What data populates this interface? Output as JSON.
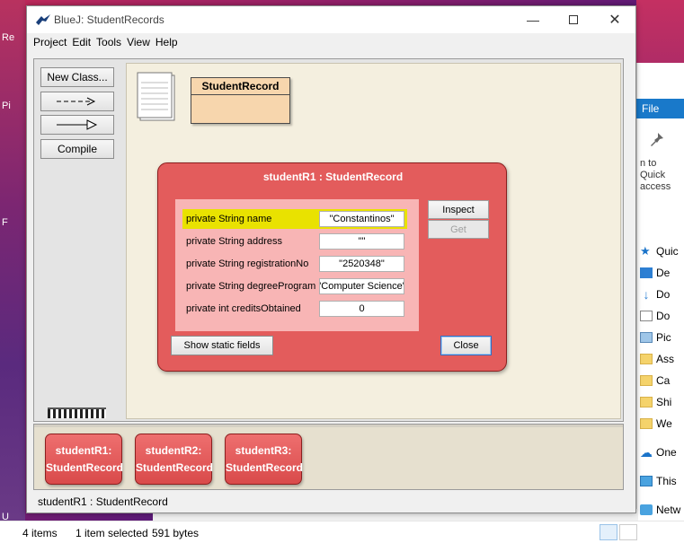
{
  "explorer": {
    "left_fragments": [
      "Re",
      "Pi",
      "F",
      "U"
    ],
    "ribbon_tab": "File",
    "pin_label": "n to Quick access",
    "nav_items": [
      {
        "label": "Quic",
        "icon": "star-icon"
      },
      {
        "label": "De",
        "icon": "desktop-icon"
      },
      {
        "label": "Do",
        "icon": "downloads-icon"
      },
      {
        "label": "Do",
        "icon": "documents-icon"
      },
      {
        "label": "Pic",
        "icon": "pictures-icon"
      },
      {
        "label": "Ass",
        "icon": "folder-icon"
      },
      {
        "label": "Ca",
        "icon": "folder-icon"
      },
      {
        "label": "Shi",
        "icon": "folder-icon"
      },
      {
        "label": "We",
        "icon": "folder-icon"
      },
      {
        "label": "One",
        "icon": "onedrive-icon"
      },
      {
        "label": "This",
        "icon": "this-pc-icon"
      },
      {
        "label": "Netw",
        "icon": "network-icon"
      }
    ],
    "status": {
      "items": "4 items",
      "selected": "1 item selected",
      "size": "591 bytes"
    }
  },
  "bluej": {
    "title": "BlueJ:  StudentRecords",
    "menu": [
      "Project",
      "Edit",
      "Tools",
      "View",
      "Help"
    ],
    "toolbar": {
      "new_class": "New Class...",
      "dep_arrow": "---->",
      "inh_arrow": "——▷",
      "compile": "Compile"
    },
    "class_name": "StudentRecord",
    "inspector": {
      "title": "studentR1 : StudentRecord",
      "fields": [
        {
          "label": "private String name",
          "value": "\"Constantinos\""
        },
        {
          "label": "private String address",
          "value": "\"\""
        },
        {
          "label": "private String registrationNo",
          "value": "\"2520348\""
        },
        {
          "label": "private String degreeProgram",
          "value": "\"Computer Science\""
        },
        {
          "label": "private int creditsObtained",
          "value": "0"
        }
      ],
      "inspect_label": "Inspect",
      "get_label": "Get",
      "show_static_label": "Show static fields",
      "close_label": "Close"
    },
    "objects": [
      {
        "line1": "studentR1:",
        "line2": "StudentRecord"
      },
      {
        "line1": "studentR2:",
        "line2": "StudentRecord"
      },
      {
        "line1": "studentR3:",
        "line2": "StudentRecord"
      }
    ],
    "status": "studentR1 : StudentRecord"
  }
}
